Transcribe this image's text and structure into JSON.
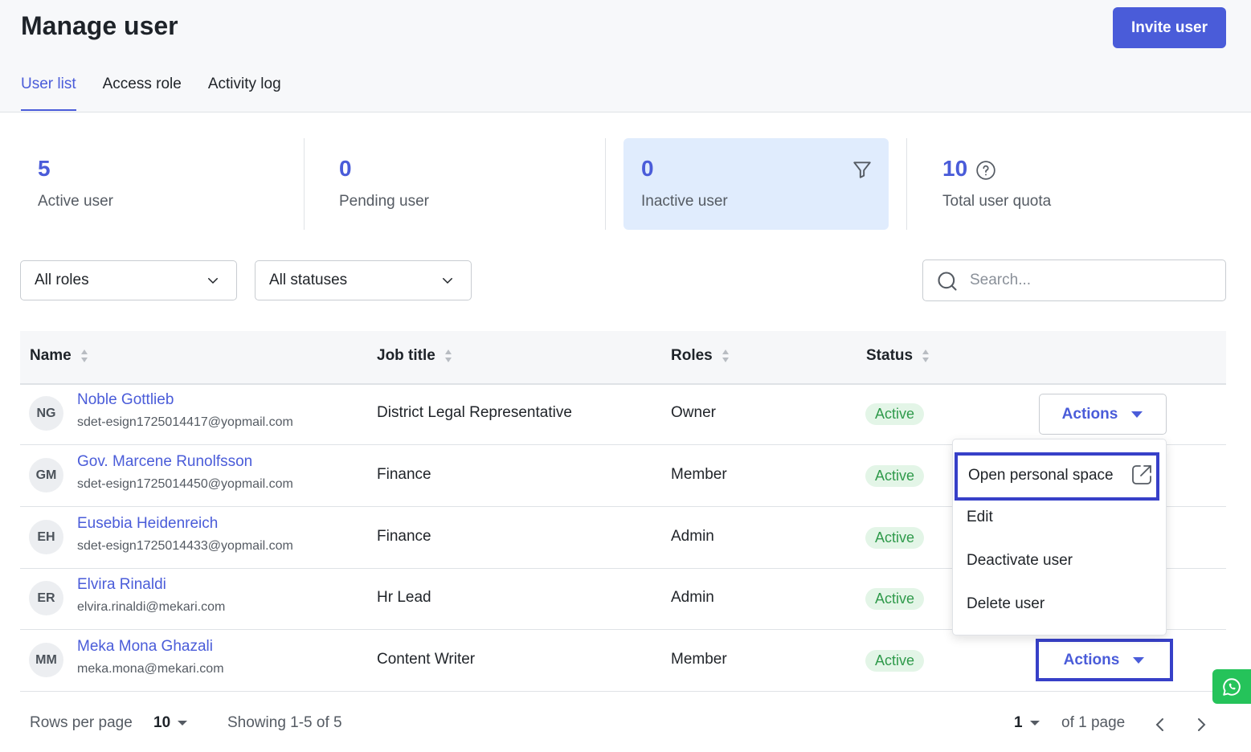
{
  "header": {
    "title": "Manage user",
    "invite_label": "Invite user"
  },
  "tabs": [
    {
      "label": "User list",
      "active": true
    },
    {
      "label": "Access role",
      "active": false
    },
    {
      "label": "Activity log",
      "active": false
    }
  ],
  "stats": [
    {
      "value": "5",
      "label": "Active user"
    },
    {
      "value": "0",
      "label": "Pending user"
    },
    {
      "value": "0",
      "label": "Inactive user"
    },
    {
      "value": "10",
      "label": "Total user quota"
    }
  ],
  "filters": {
    "roles": "All roles",
    "statuses": "All statuses",
    "search_placeholder": "Search..."
  },
  "table": {
    "columns": [
      "Name",
      "Job title",
      "Roles",
      "Status"
    ],
    "rows": [
      {
        "initials": "NG",
        "name": "Noble Gottlieb",
        "email": "sdet-esign1725014417@yopmail.com",
        "job_title": "District Legal Representative",
        "role": "Owner",
        "status": "Active"
      },
      {
        "initials": "GM",
        "name": "Gov. Marcene Runolfsson",
        "email": "sdet-esign1725014450@yopmail.com",
        "job_title": "Finance",
        "role": "Member",
        "status": "Active"
      },
      {
        "initials": "EH",
        "name": "Eusebia Heidenreich",
        "email": "sdet-esign1725014433@yopmail.com",
        "job_title": "Finance",
        "role": "Admin",
        "status": "Active"
      },
      {
        "initials": "ER",
        "name": "Elvira Rinaldi",
        "email": "elvira.rinaldi@mekari.com",
        "job_title": "Hr Lead",
        "role": "Admin",
        "status": "Active"
      },
      {
        "initials": "MM",
        "name": "Meka Mona Ghazali",
        "email": "meka.mona@mekari.com",
        "job_title": "Content Writer",
        "role": "Member",
        "status": "Active"
      }
    ],
    "actions_label": "Actions"
  },
  "actions_menu": {
    "items": [
      "Open personal space",
      "Edit",
      "Deactivate user",
      "Delete user"
    ]
  },
  "footer": {
    "rows_per_page_label": "Rows per page",
    "rows_per_page_value": "10",
    "showing": "Showing 1-5 of 5",
    "current_page": "1",
    "of_pages": "of 1 page"
  },
  "colors": {
    "accent": "#4a5cd9",
    "active_badge_bg": "#e3f5e7",
    "active_badge_text": "#2f9a4b",
    "highlight_box": "#3740c8",
    "whatsapp": "#25c35a"
  },
  "icons": [
    "filter-icon",
    "help-circle-icon",
    "chevron-down-icon",
    "search-icon",
    "sort-icon",
    "caret-down-icon",
    "external-link-icon",
    "chevron-left-icon",
    "chevron-right-icon",
    "whatsapp-icon"
  ]
}
